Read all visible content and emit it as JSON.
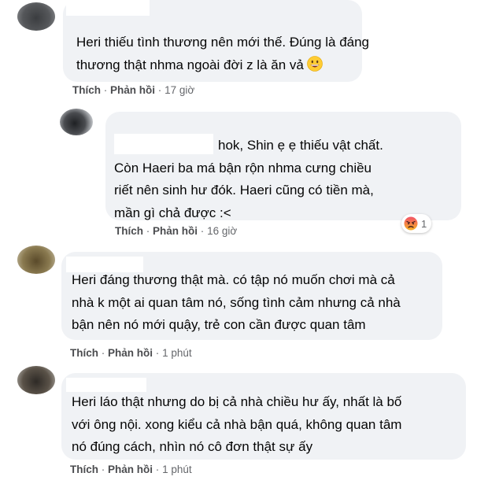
{
  "comments": [
    {
      "lines": [
        "Heri thiếu tình thương nên mới thế. Đúng là đáng",
        "thương thật nhma ngoài đời z là ăn vả"
      ],
      "emoji": "grinning-face",
      "like": "Thích",
      "reply": "Phản hồi",
      "sep": "·",
      "time": "17 giờ"
    },
    {
      "lines": [
        "hok, Shin ẹ ẹ thiếu vật chất.",
        "Còn Haeri ba má bận rộn nhma cưng chiều",
        "riết nên sinh hư đók. Haeri cũng có tiền mà,",
        "mần gì chả được :<"
      ],
      "reaction_icon": "angry-face-icon",
      "reaction_count": "1",
      "like": "Thích",
      "reply": "Phản hồi",
      "sep": "·",
      "time": "16 giờ"
    },
    {
      "lines": [
        "Heri đáng thương thật mà. có tập nó muốn chơi mà cả",
        "nhà k một ai quan tâm nó, sống tình cảm nhưng cả nhà",
        "bận nên nó mới quậy, trẻ con cần được quan tâm"
      ],
      "like": "Thích",
      "reply": "Phản hồi",
      "sep": "·",
      "time": "1 phút"
    },
    {
      "lines": [
        "Heri láo thật nhưng do bị cả nhà chiều hư ấy, nhất là bố",
        "với ông nội. xong kiểu cả nhà bận quá, không quan tâm",
        "nó đúng cách, nhìn nó cô đơn thật sự ấy"
      ],
      "like": "Thích",
      "reply": "Phản hồi",
      "sep": "·",
      "time": "1 phút"
    }
  ],
  "colors": {
    "bubble": "#f0f2f5",
    "text": "#050505",
    "meta": "#65676b",
    "background": "#ffffff"
  }
}
